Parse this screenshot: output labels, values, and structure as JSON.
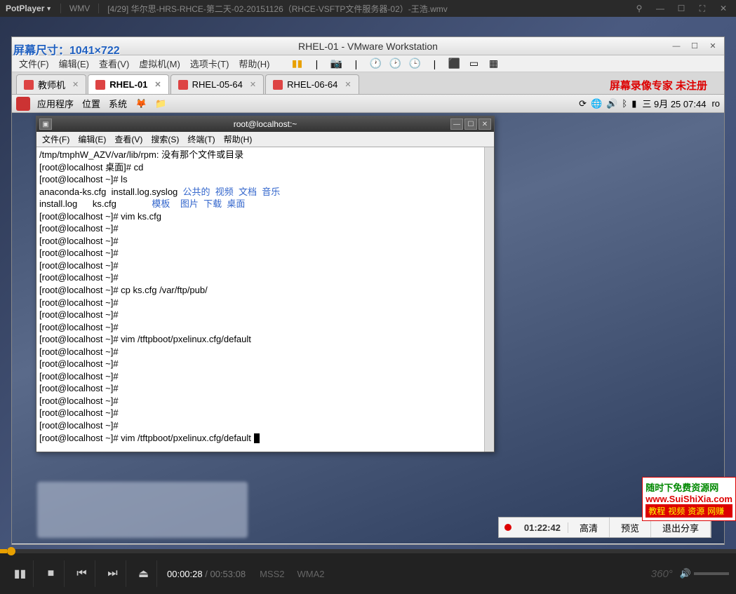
{
  "potplayer": {
    "app": "PotPlayer",
    "format": "WMV",
    "title": "[4/29] 华尔思-HRS-RHCE-第二天-02-20151126（RHCE-VSFTP文件服务器-02）-王浩.wmv",
    "current_time": "00:00:28",
    "duration": "00:53:08",
    "codec_v": "MSS2",
    "codec_a": "WMA2",
    "mode_360": "360°"
  },
  "screen_overlay": "屏幕尺寸：1041×722",
  "rec_overlay": "屏幕录像专家  未注册",
  "vmware": {
    "title": "RHEL-01 - VMware Workstation",
    "menus": [
      "文件(F)",
      "编辑(E)",
      "查看(V)",
      "虚拟机(M)",
      "选项卡(T)",
      "帮助(H)"
    ],
    "tabs": [
      {
        "label": "教师机",
        "active": false
      },
      {
        "label": "RHEL-01",
        "active": true
      },
      {
        "label": "RHEL-05-64",
        "active": false
      },
      {
        "label": "RHEL-06-64",
        "active": false
      }
    ]
  },
  "gnome": {
    "menus": [
      "应用程序",
      "位置",
      "系统"
    ],
    "clock": "三  9月 25 07:44",
    "user": "ro"
  },
  "terminal": {
    "title": "root@localhost:~",
    "menus": [
      "文件(F)",
      "编辑(E)",
      "查看(V)",
      "搜索(S)",
      "终端(T)",
      "帮助(H)"
    ],
    "lines": [
      {
        "t": "/tmp/tmphW_AZV/var/lib/rpm: 没有那个文件或目录"
      },
      {
        "t": "[root@localhost 桌面]# cd"
      },
      {
        "t": "[root@localhost ~]# ls"
      },
      {
        "t": "anaconda-ks.cfg  install.log.syslog  ",
        "suffix": [
          [
            "公共的",
            "blue"
          ],
          [
            "  "
          ],
          [
            "视频",
            "blue"
          ],
          [
            "  "
          ],
          [
            "文档",
            "blue"
          ],
          [
            "  "
          ],
          [
            "音乐",
            "blue"
          ]
        ]
      },
      {
        "t": "install.log      ks.cfg              ",
        "suffix": [
          [
            "模板",
            "blue"
          ],
          [
            "    "
          ],
          [
            "图片",
            "blue"
          ],
          [
            "  "
          ],
          [
            "下载",
            "blue"
          ],
          [
            "  "
          ],
          [
            "桌面",
            "blue"
          ]
        ]
      },
      {
        "t": "[root@localhost ~]# vim ks.cfg"
      },
      {
        "t": "[root@localhost ~]# "
      },
      {
        "t": "[root@localhost ~]# "
      },
      {
        "t": "[root@localhost ~]# "
      },
      {
        "t": "[root@localhost ~]# "
      },
      {
        "t": "[root@localhost ~]# "
      },
      {
        "t": "[root@localhost ~]# cp ks.cfg /var/ftp/pub/"
      },
      {
        "t": "[root@localhost ~]# "
      },
      {
        "t": "[root@localhost ~]# "
      },
      {
        "t": "[root@localhost ~]# "
      },
      {
        "t": "[root@localhost ~]# vim /tftpboot/pxelinux.cfg/default"
      },
      {
        "t": "[root@localhost ~]# "
      },
      {
        "t": "[root@localhost ~]# "
      },
      {
        "t": "[root@localhost ~]# "
      },
      {
        "t": "[root@localhost ~]# "
      },
      {
        "t": "[root@localhost ~]# "
      },
      {
        "t": "[root@localhost ~]# "
      },
      {
        "t": "[root@localhost ~]# "
      },
      {
        "t": "[root@localhost ~]# vim /tftpboot/pxelinux.cfg/default ",
        "cursor": true
      }
    ]
  },
  "recbar": {
    "time": "01:22:42",
    "btns": [
      "高清",
      "预览",
      "退出分享"
    ]
  },
  "watermark": {
    "l1": "随时下免费资源网",
    "l2": "www.SuiShiXia.com",
    "l3": [
      "教程",
      "视频",
      "资源",
      "网赚"
    ]
  }
}
